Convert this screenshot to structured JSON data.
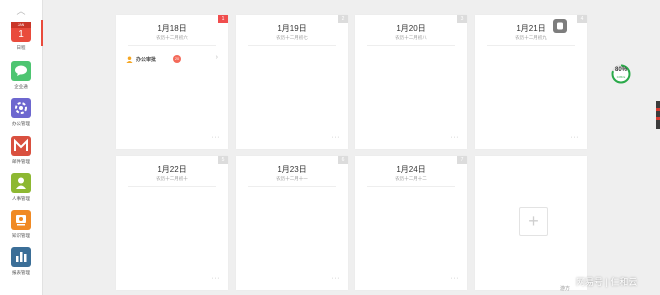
{
  "sidebar": {
    "items": [
      {
        "label": "日程",
        "icon": "calendar-icon",
        "color": "#e94b3c",
        "icon_month": "JAN",
        "icon_day": "1"
      },
      {
        "label": "企业通",
        "icon": "chat-bubble-icon",
        "color": "#4dc571"
      },
      {
        "label": "办公管理",
        "icon": "office-gear-icon",
        "color": "#6d67cf"
      },
      {
        "label": "邮件管理",
        "icon": "mail-icon",
        "color": "#d9503f"
      },
      {
        "label": "人事管理",
        "icon": "person-icon",
        "color": "#8db832"
      },
      {
        "label": "知识管理",
        "icon": "knowledge-icon",
        "color": "#f08a24"
      },
      {
        "label": "报表管理",
        "icon": "bar-chart-icon",
        "color": "#3b6e97"
      }
    ]
  },
  "days": [
    {
      "date": "1月18日",
      "lunar": "农历十二月初六",
      "corner": "1",
      "more": "···",
      "schedule": {
        "title": "办公审批",
        "badge": "20"
      }
    },
    {
      "date": "1月19日",
      "lunar": "农历十二月初七",
      "corner": "2",
      "more": "···"
    },
    {
      "date": "1月20日",
      "lunar": "农历十二月初八",
      "corner": "3",
      "more": "···"
    },
    {
      "date": "1月21日",
      "lunar": "农历十二月初九",
      "corner": "4",
      "more": "···"
    },
    {
      "date": "1月22日",
      "lunar": "农历十二月初十",
      "corner": "5",
      "more": "···"
    },
    {
      "date": "1月23日",
      "lunar": "农历十二月十一",
      "corner": "6",
      "more": "···"
    },
    {
      "date": "1月24日",
      "lunar": "农历十二月十二",
      "corner": "7",
      "more": "···"
    }
  ],
  "add_card": {
    "symbol": "+"
  },
  "memory": {
    "percent": "80%",
    "percent_value": 0.8,
    "sub": "0.8K/s",
    "color": "#2aaa4a"
  },
  "watermark": {
    "brand": "网易号 | 仁和云",
    "small": "游方"
  }
}
